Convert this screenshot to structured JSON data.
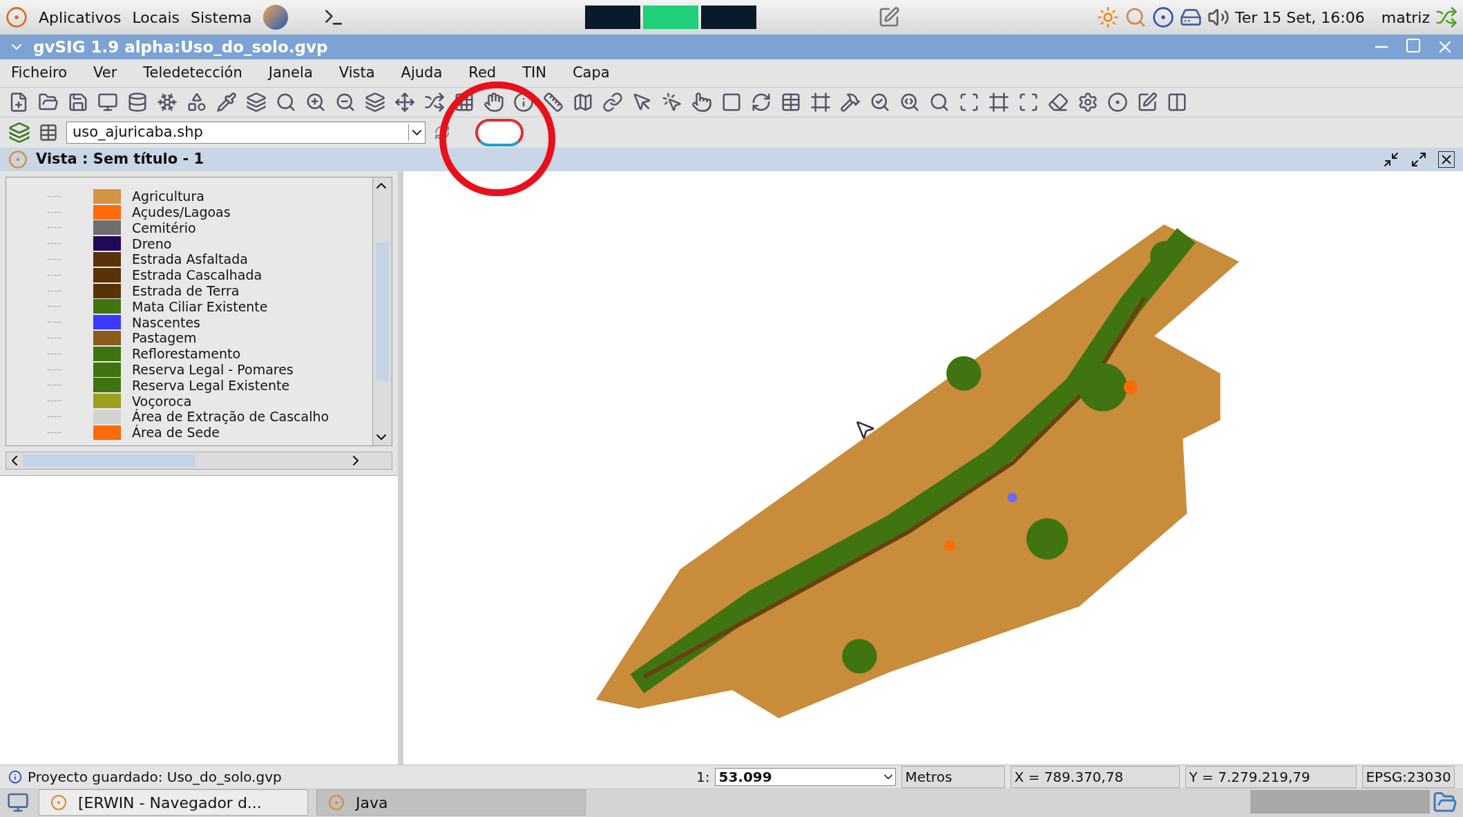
{
  "top_panel": {
    "menus": [
      "Aplicativos",
      "Locais",
      "Sistema"
    ],
    "clock": "Ter 15 Set, 16:06",
    "user": "matriz"
  },
  "window": {
    "title": "gvSIG 1.9 alpha:Uso_do_solo.gvp"
  },
  "menu_bar": [
    "Ficheiro",
    "Ver",
    "Teledetección",
    "Janela",
    "Vista",
    "Ajuda",
    "Red",
    "TIN",
    "Capa"
  ],
  "layer_selector": {
    "value": "uso_ajuricaba.shp"
  },
  "view": {
    "title": "Vista : Sem título - 1"
  },
  "legend": [
    {
      "label": "Agricultura",
      "color": "#d39443"
    },
    {
      "label": "Açudes/Lagoas",
      "color": "#ff6a0a"
    },
    {
      "label": "Cemitério",
      "color": "#6e6e6e"
    },
    {
      "label": "Dreno",
      "color": "#220a5a"
    },
    {
      "label": "Estrada Asfaltada",
      "color": "#5a3208"
    },
    {
      "label": "Estrada Cascalhada",
      "color": "#5a3208"
    },
    {
      "label": "Estrada de Terra",
      "color": "#5a3208"
    },
    {
      "label": "Mata Ciliar Existente",
      "color": "#3f7410"
    },
    {
      "label": "Nascentes",
      "color": "#3a3aff"
    },
    {
      "label": "Pastagem",
      "color": "#8a5c1c"
    },
    {
      "label": "Reflorestamento",
      "color": "#3f7410"
    },
    {
      "label": "Reserva Legal - Pomares",
      "color": "#3f7410"
    },
    {
      "label": "Reserva Legal Existente",
      "color": "#3f7410"
    },
    {
      "label": "Voçoroca",
      "color": "#9aa01e"
    },
    {
      "label": "Área de Extração de Cascalho",
      "color": "#d2d2d2"
    },
    {
      "label": "Área de Sede",
      "color": "#ff6a0a"
    }
  ],
  "status_bar": {
    "message": "Proyecto guardado: Uso_do_solo.gvp",
    "scale_prefix": "1:",
    "scale": "53.099",
    "units": "Metros",
    "x": "X = 789.370,78",
    "y": "Y = 7.279.219,79",
    "crs": "EPSG:23030"
  },
  "taskbar": [
    {
      "label": "[ERWIN - Navegador d...",
      "selected": false
    },
    {
      "label": "Java",
      "selected": true
    }
  ]
}
